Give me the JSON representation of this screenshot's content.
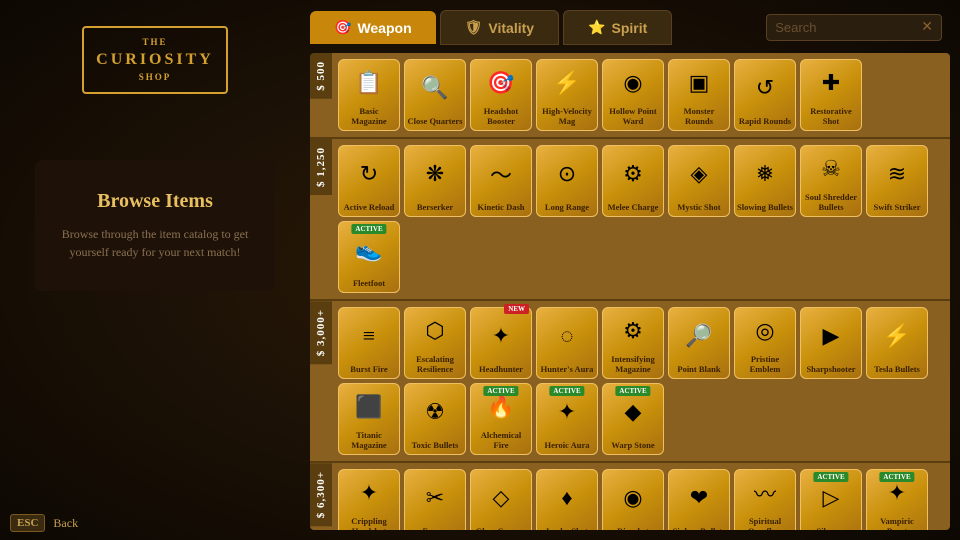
{
  "logo": {
    "the": "THE",
    "curiosity": "CURIOSITY",
    "shop": "SHOP"
  },
  "browse": {
    "title": "Browse Items",
    "description": "Browse through the item catalog to get yourself ready for your next match!"
  },
  "tabs": [
    {
      "id": "weapon",
      "label": "Weapon",
      "icon": "🎯",
      "active": true
    },
    {
      "id": "vitality",
      "label": "Vitality",
      "icon": "🛡",
      "active": false
    },
    {
      "id": "spirit",
      "label": "Spirit",
      "icon": "⭐",
      "active": false
    }
  ],
  "search": {
    "placeholder": "Search",
    "close_icon": "✕"
  },
  "price_sections": [
    {
      "price": "$ 500",
      "items": [
        {
          "name": "Basic Magazine",
          "icon": "📋",
          "active": false,
          "new": false
        },
        {
          "name": "Close Quarters",
          "icon": "🔍",
          "active": false,
          "new": false
        },
        {
          "name": "Headshot Booster",
          "icon": "🎯",
          "active": false,
          "new": false
        },
        {
          "name": "High-Velocity Mag",
          "icon": "⚡",
          "active": false,
          "new": false
        },
        {
          "name": "Hollow Point Ward",
          "icon": "◎",
          "active": false,
          "new": false
        },
        {
          "name": "Monster Rounds",
          "icon": "🔲",
          "active": false,
          "new": false
        },
        {
          "name": "Rapid Rounds",
          "icon": "🔄",
          "active": false,
          "new": false
        },
        {
          "name": "Restorative Shot",
          "icon": "➕",
          "active": false,
          "new": false
        }
      ]
    },
    {
      "price": "$ 1,250",
      "items": [
        {
          "name": "Active Reload",
          "icon": "🔃",
          "active": false,
          "new": false
        },
        {
          "name": "Berserker",
          "icon": "🌸",
          "active": false,
          "new": false
        },
        {
          "name": "Kinetic Dash",
          "icon": "🌊",
          "active": false,
          "new": false
        },
        {
          "name": "Long Range",
          "icon": "🎯",
          "active": false,
          "new": false
        },
        {
          "name": "Melee Charge",
          "icon": "⚙",
          "active": false,
          "new": false
        },
        {
          "name": "Mystic Shot",
          "icon": "🔮",
          "active": false,
          "new": false
        },
        {
          "name": "Slowing Bullets",
          "icon": "🐢",
          "active": false,
          "new": false
        },
        {
          "name": "Soul Shredder Bullets",
          "icon": "💀",
          "active": false,
          "new": false
        },
        {
          "name": "Swift Striker",
          "icon": "≡≡",
          "active": false,
          "new": false
        },
        {
          "name": "Fleetfoot",
          "icon": "👟",
          "active": true,
          "new": false
        }
      ]
    },
    {
      "price": "$ 3,000+",
      "items": [
        {
          "name": "Burst Fire",
          "icon": "≡≡",
          "active": false,
          "new": false
        },
        {
          "name": "Escalating Resilience",
          "icon": "🔰",
          "active": false,
          "new": false
        },
        {
          "name": "Headhunter",
          "icon": "🎯",
          "active": false,
          "new": true
        },
        {
          "name": "Hunter's Aura",
          "icon": "🌀",
          "active": false,
          "new": false
        },
        {
          "name": "Intensifying Magazine",
          "icon": "⚙",
          "active": false,
          "new": false
        },
        {
          "name": "Point Blank",
          "icon": "🔍",
          "active": false,
          "new": false
        },
        {
          "name": "Pristine Emblem",
          "icon": "🔍",
          "active": false,
          "new": false
        },
        {
          "name": "Sharpshooter",
          "icon": "▶",
          "active": false,
          "new": false
        },
        {
          "name": "Tesla Bullets",
          "icon": "⚡",
          "active": false,
          "new": false
        },
        {
          "name": "Titanic Magazine",
          "icon": "📦",
          "active": false,
          "new": false
        },
        {
          "name": "Toxic Bullets",
          "icon": "☠",
          "active": false,
          "new": false
        },
        {
          "name": "Alchemical Fire",
          "icon": "🔥",
          "active": true,
          "new": false
        },
        {
          "name": "Heroic Aura",
          "icon": "✨",
          "active": true,
          "new": false
        },
        {
          "name": "Warp Stone",
          "icon": "💎",
          "active": true,
          "new": false
        }
      ]
    },
    {
      "price": "$ 6,300+",
      "items": [
        {
          "name": "Crippling Headshot",
          "icon": "🎯",
          "active": false,
          "new": false
        },
        {
          "name": "Frenzy",
          "icon": "✂",
          "active": false,
          "new": false
        },
        {
          "name": "Glass Cannon",
          "icon": "💠",
          "active": false,
          "new": false
        },
        {
          "name": "Lucky Shot",
          "icon": "💔",
          "active": false,
          "new": false
        },
        {
          "name": "Ricochet",
          "icon": "◎",
          "active": false,
          "new": false
        },
        {
          "name": "Siphon Bullets",
          "icon": "❤",
          "active": false,
          "new": false
        },
        {
          "name": "Spiritual Overflow",
          "icon": "🌊",
          "active": false,
          "new": false
        },
        {
          "name": "Silencer",
          "icon": "▶",
          "active": true,
          "new": false
        },
        {
          "name": "Vampiric Burst",
          "icon": "🦇",
          "active": true,
          "new": false
        }
      ]
    }
  ],
  "footer": {
    "esc_label": "ESC",
    "back_label": "Back"
  }
}
